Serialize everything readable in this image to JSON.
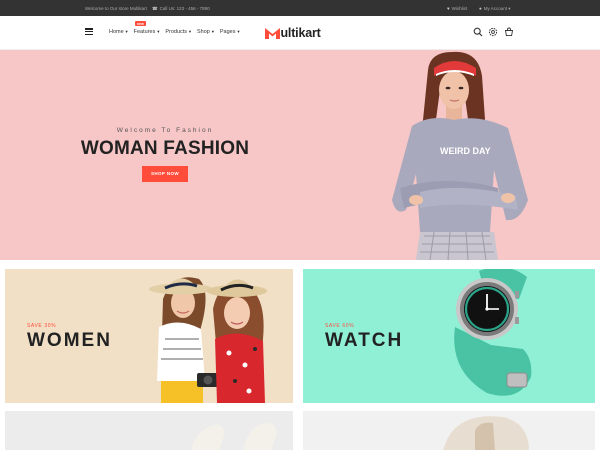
{
  "topbar": {
    "welcome": "Welcome to Our store Multikart",
    "phone": "Call Us: 123 - 456 - 7890",
    "wishlist": "Wishlist",
    "account": "My Account"
  },
  "header": {
    "logo_initial": "M",
    "logo_rest": "ultikart",
    "badge": "new",
    "nav": [
      {
        "label": "Home"
      },
      {
        "label": "Features"
      },
      {
        "label": "Products"
      },
      {
        "label": "Shop"
      },
      {
        "label": "Pages"
      }
    ],
    "icons": [
      "search-icon",
      "settings-icon",
      "cart-icon"
    ]
  },
  "hero": {
    "subtitle": "Welcome To Fashion",
    "title": "WOMAN FASHION",
    "button": "SHOP NOW",
    "shirt_print": "WEIRD DAY"
  },
  "banners": [
    {
      "save": "SAVE 30%",
      "title": "WOMEN"
    },
    {
      "save": "SAVE 60%",
      "title": "WATCH"
    }
  ],
  "colors": {
    "accent": "#ff4c3b",
    "topbar": "#333333",
    "hero_bg": "#f7c6c6",
    "women_bg": "#f1dfc6",
    "watch_bg": "#8ff0d6"
  }
}
